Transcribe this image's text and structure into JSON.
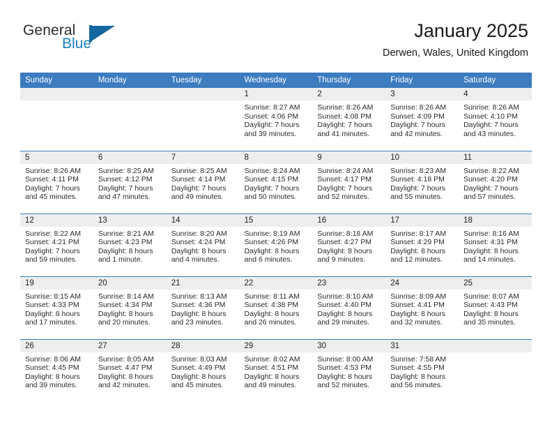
{
  "brand": {
    "name_part1": "General",
    "name_part2": "Blue"
  },
  "header": {
    "month_title": "January 2025",
    "location": "Derwen, Wales, United Kingdom"
  },
  "colors": {
    "header_blue": "#3c7cbf",
    "brand_blue": "#1a7dc4",
    "daynum_band": "#eeeeee"
  },
  "calendar": {
    "weekday_headers": [
      "Sunday",
      "Monday",
      "Tuesday",
      "Wednesday",
      "Thursday",
      "Friday",
      "Saturday"
    ],
    "weeks": [
      [
        {
          "day": "",
          "empty": true
        },
        {
          "day": "",
          "empty": true
        },
        {
          "day": "",
          "empty": true
        },
        {
          "day": "1",
          "sunrise": "Sunrise: 8:27 AM",
          "sunset": "Sunset: 4:06 PM",
          "daylight_line1": "Daylight: 7 hours",
          "daylight_line2": "and 39 minutes."
        },
        {
          "day": "2",
          "sunrise": "Sunrise: 8:26 AM",
          "sunset": "Sunset: 4:08 PM",
          "daylight_line1": "Daylight: 7 hours",
          "daylight_line2": "and 41 minutes."
        },
        {
          "day": "3",
          "sunrise": "Sunrise: 8:26 AM",
          "sunset": "Sunset: 4:09 PM",
          "daylight_line1": "Daylight: 7 hours",
          "daylight_line2": "and 42 minutes."
        },
        {
          "day": "4",
          "sunrise": "Sunrise: 8:26 AM",
          "sunset": "Sunset: 4:10 PM",
          "daylight_line1": "Daylight: 7 hours",
          "daylight_line2": "and 43 minutes."
        }
      ],
      [
        {
          "day": "5",
          "sunrise": "Sunrise: 8:26 AM",
          "sunset": "Sunset: 4:11 PM",
          "daylight_line1": "Daylight: 7 hours",
          "daylight_line2": "and 45 minutes."
        },
        {
          "day": "6",
          "sunrise": "Sunrise: 8:25 AM",
          "sunset": "Sunset: 4:12 PM",
          "daylight_line1": "Daylight: 7 hours",
          "daylight_line2": "and 47 minutes."
        },
        {
          "day": "7",
          "sunrise": "Sunrise: 8:25 AM",
          "sunset": "Sunset: 4:14 PM",
          "daylight_line1": "Daylight: 7 hours",
          "daylight_line2": "and 49 minutes."
        },
        {
          "day": "8",
          "sunrise": "Sunrise: 8:24 AM",
          "sunset": "Sunset: 4:15 PM",
          "daylight_line1": "Daylight: 7 hours",
          "daylight_line2": "and 50 minutes."
        },
        {
          "day": "9",
          "sunrise": "Sunrise: 8:24 AM",
          "sunset": "Sunset: 4:17 PM",
          "daylight_line1": "Daylight: 7 hours",
          "daylight_line2": "and 52 minutes."
        },
        {
          "day": "10",
          "sunrise": "Sunrise: 8:23 AM",
          "sunset": "Sunset: 4:18 PM",
          "daylight_line1": "Daylight: 7 hours",
          "daylight_line2": "and 55 minutes."
        },
        {
          "day": "11",
          "sunrise": "Sunrise: 8:22 AM",
          "sunset": "Sunset: 4:20 PM",
          "daylight_line1": "Daylight: 7 hours",
          "daylight_line2": "and 57 minutes."
        }
      ],
      [
        {
          "day": "12",
          "sunrise": "Sunrise: 8:22 AM",
          "sunset": "Sunset: 4:21 PM",
          "daylight_line1": "Daylight: 7 hours",
          "daylight_line2": "and 59 minutes."
        },
        {
          "day": "13",
          "sunrise": "Sunrise: 8:21 AM",
          "sunset": "Sunset: 4:23 PM",
          "daylight_line1": "Daylight: 8 hours",
          "daylight_line2": "and 1 minute."
        },
        {
          "day": "14",
          "sunrise": "Sunrise: 8:20 AM",
          "sunset": "Sunset: 4:24 PM",
          "daylight_line1": "Daylight: 8 hours",
          "daylight_line2": "and 4 minutes."
        },
        {
          "day": "15",
          "sunrise": "Sunrise: 8:19 AM",
          "sunset": "Sunset: 4:26 PM",
          "daylight_line1": "Daylight: 8 hours",
          "daylight_line2": "and 6 minutes."
        },
        {
          "day": "16",
          "sunrise": "Sunrise: 8:18 AM",
          "sunset": "Sunset: 4:27 PM",
          "daylight_line1": "Daylight: 8 hours",
          "daylight_line2": "and 9 minutes."
        },
        {
          "day": "17",
          "sunrise": "Sunrise: 8:17 AM",
          "sunset": "Sunset: 4:29 PM",
          "daylight_line1": "Daylight: 8 hours",
          "daylight_line2": "and 12 minutes."
        },
        {
          "day": "18",
          "sunrise": "Sunrise: 8:16 AM",
          "sunset": "Sunset: 4:31 PM",
          "daylight_line1": "Daylight: 8 hours",
          "daylight_line2": "and 14 minutes."
        }
      ],
      [
        {
          "day": "19",
          "sunrise": "Sunrise: 8:15 AM",
          "sunset": "Sunset: 4:33 PM",
          "daylight_line1": "Daylight: 8 hours",
          "daylight_line2": "and 17 minutes."
        },
        {
          "day": "20",
          "sunrise": "Sunrise: 8:14 AM",
          "sunset": "Sunset: 4:34 PM",
          "daylight_line1": "Daylight: 8 hours",
          "daylight_line2": "and 20 minutes."
        },
        {
          "day": "21",
          "sunrise": "Sunrise: 8:13 AM",
          "sunset": "Sunset: 4:36 PM",
          "daylight_line1": "Daylight: 8 hours",
          "daylight_line2": "and 23 minutes."
        },
        {
          "day": "22",
          "sunrise": "Sunrise: 8:11 AM",
          "sunset": "Sunset: 4:38 PM",
          "daylight_line1": "Daylight: 8 hours",
          "daylight_line2": "and 26 minutes."
        },
        {
          "day": "23",
          "sunrise": "Sunrise: 8:10 AM",
          "sunset": "Sunset: 4:40 PM",
          "daylight_line1": "Daylight: 8 hours",
          "daylight_line2": "and 29 minutes."
        },
        {
          "day": "24",
          "sunrise": "Sunrise: 8:09 AM",
          "sunset": "Sunset: 4:41 PM",
          "daylight_line1": "Daylight: 8 hours",
          "daylight_line2": "and 32 minutes."
        },
        {
          "day": "25",
          "sunrise": "Sunrise: 8:07 AM",
          "sunset": "Sunset: 4:43 PM",
          "daylight_line1": "Daylight: 8 hours",
          "daylight_line2": "and 35 minutes."
        }
      ],
      [
        {
          "day": "26",
          "sunrise": "Sunrise: 8:06 AM",
          "sunset": "Sunset: 4:45 PM",
          "daylight_line1": "Daylight: 8 hours",
          "daylight_line2": "and 39 minutes."
        },
        {
          "day": "27",
          "sunrise": "Sunrise: 8:05 AM",
          "sunset": "Sunset: 4:47 PM",
          "daylight_line1": "Daylight: 8 hours",
          "daylight_line2": "and 42 minutes."
        },
        {
          "day": "28",
          "sunrise": "Sunrise: 8:03 AM",
          "sunset": "Sunset: 4:49 PM",
          "daylight_line1": "Daylight: 8 hours",
          "daylight_line2": "and 45 minutes."
        },
        {
          "day": "29",
          "sunrise": "Sunrise: 8:02 AM",
          "sunset": "Sunset: 4:51 PM",
          "daylight_line1": "Daylight: 8 hours",
          "daylight_line2": "and 49 minutes."
        },
        {
          "day": "30",
          "sunrise": "Sunrise: 8:00 AM",
          "sunset": "Sunset: 4:53 PM",
          "daylight_line1": "Daylight: 8 hours",
          "daylight_line2": "and 52 minutes."
        },
        {
          "day": "31",
          "sunrise": "Sunrise: 7:58 AM",
          "sunset": "Sunset: 4:55 PM",
          "daylight_line1": "Daylight: 8 hours",
          "daylight_line2": "and 56 minutes."
        },
        {
          "day": "",
          "empty": true
        }
      ]
    ]
  }
}
